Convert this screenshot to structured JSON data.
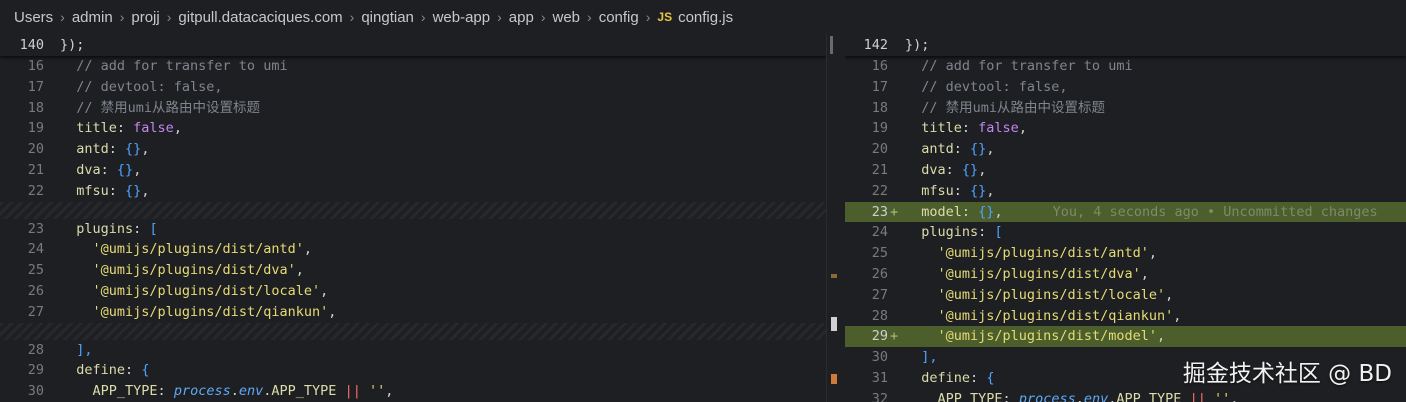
{
  "breadcrumb": {
    "items": [
      "Users",
      "admin",
      "projj",
      "gitpull.datacaciques.com",
      "qingtian",
      "web-app",
      "app",
      "web",
      "config"
    ],
    "file_badge": "JS",
    "file_name": "config.js"
  },
  "left": {
    "sticky": {
      "line_no": "140",
      "text": "});"
    },
    "lines": [
      {
        "n": "16",
        "text": "  // add for transfer to umi"
      },
      {
        "n": "17",
        "text": "  // devtool: false,"
      },
      {
        "n": "18",
        "text": "  // 禁用umi从路由中设置标题"
      },
      {
        "n": "19",
        "prop": "title",
        "val": "false"
      },
      {
        "n": "20",
        "prop": "antd",
        "val": "{}"
      },
      {
        "n": "21",
        "prop": "dva",
        "val": "{}"
      },
      {
        "n": "22",
        "prop": "mfsu",
        "val": "{}"
      },
      {
        "n": "23",
        "prop": "plugins",
        "open": "["
      },
      {
        "n": "24",
        "str": "'@umijs/plugins/dist/antd'"
      },
      {
        "n": "25",
        "str": "'@umijs/plugins/dist/dva'"
      },
      {
        "n": "26",
        "str": "'@umijs/plugins/dist/locale'"
      },
      {
        "n": "27",
        "str": "'@umijs/plugins/dist/qiankun'"
      },
      {
        "n": "28",
        "close": "],"
      },
      {
        "n": "29",
        "prop": "define",
        "open": "{"
      },
      {
        "n": "30",
        "env_key": "APP_TYPE",
        "env_obj": "process",
        "env_mid": "env",
        "env_prop": "APP_TYPE",
        "env_op": "||",
        "env_str": "''"
      }
    ]
  },
  "right": {
    "sticky": {
      "line_no": "142",
      "text": "});"
    },
    "lines": [
      {
        "n": "16",
        "text": "  // add for transfer to umi"
      },
      {
        "n": "17",
        "text": "  // devtool: false,"
      },
      {
        "n": "18",
        "text": "  // 禁用umi从路由中设置标题"
      },
      {
        "n": "19",
        "prop": "title",
        "val": "false"
      },
      {
        "n": "20",
        "prop": "antd",
        "val": "{}"
      },
      {
        "n": "21",
        "prop": "dva",
        "val": "{}"
      },
      {
        "n": "22",
        "prop": "mfsu",
        "val": "{}"
      },
      {
        "n": "23",
        "prop": "model",
        "val": "{}",
        "added": true,
        "blame": "You, 4 seconds ago • Uncommitted changes"
      },
      {
        "n": "24",
        "prop": "plugins",
        "open": "["
      },
      {
        "n": "25",
        "str": "'@umijs/plugins/dist/antd'"
      },
      {
        "n": "26",
        "str": "'@umijs/plugins/dist/dva'"
      },
      {
        "n": "27",
        "str": "'@umijs/plugins/dist/locale'"
      },
      {
        "n": "28",
        "str": "'@umijs/plugins/dist/qiankun'"
      },
      {
        "n": "29",
        "str": "'@umijs/plugins/dist/model'",
        "added": true
      },
      {
        "n": "30",
        "close": "],"
      },
      {
        "n": "31",
        "prop": "define",
        "open": "{"
      },
      {
        "n": "32",
        "env_key": "APP_TYPE",
        "env_obj": "process",
        "env_mid": "env",
        "env_prop": "APP_TYPE",
        "env_op": "||",
        "env_str": "''"
      }
    ]
  },
  "added_marker": "+",
  "watermark": "掘金技术社区 @ BD",
  "colors": {
    "added_background": "#4b5e2b",
    "keyword_false": "#c586f0",
    "brace": "#4fa3ff",
    "string": "#e6db74",
    "comment": "#7f848e"
  }
}
